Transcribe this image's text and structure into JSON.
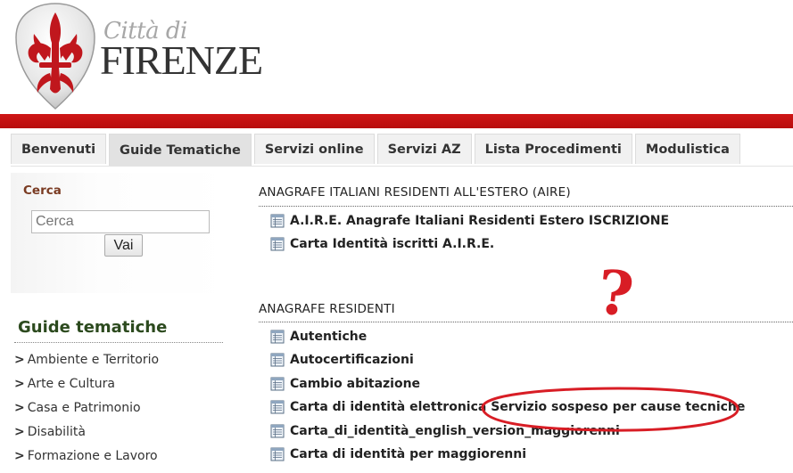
{
  "header": {
    "logo_line1": "Città di",
    "logo_line2": "FIRENZE",
    "brand_red": "#c41111"
  },
  "tabs": [
    {
      "label": "Benvenuti",
      "active": false
    },
    {
      "label": "Guide Tematiche",
      "active": true
    },
    {
      "label": "Servizi online",
      "active": false
    },
    {
      "label": "Servizi AZ",
      "active": false
    },
    {
      "label": "Lista Procedimenti",
      "active": false
    },
    {
      "label": "Modulistica",
      "active": false
    }
  ],
  "search": {
    "title": "Cerca",
    "placeholder": "Cerca",
    "button_label": "Vai"
  },
  "guide": {
    "title": "Guide tematiche",
    "items": [
      "Ambiente e Territorio",
      "Arte e Cultura",
      "Casa e Patrimonio",
      "Disabilità",
      "Formazione e Lavoro"
    ]
  },
  "sections": [
    {
      "title": "ANAGRAFE ITALIANI RESIDENTI ALL'ESTERO (AIRE)",
      "items": [
        "A.I.R.E. Anagrafe Italiani Residenti Estero ISCRIZIONE",
        "Carta Identità iscritti A.I.R.E."
      ]
    },
    {
      "title": "ANAGRAFE RESIDENTI",
      "items": [
        "Autentiche",
        "Autocertificazioni",
        "Cambio abitazione",
        "Carta di identità elettronica Servizio sospeso per cause tecniche",
        "Carta_di_identità_english_version_maggiorenni",
        "Carta di identità per maggiorenni"
      ]
    }
  ],
  "annotation": {
    "mark": "?",
    "color": "#d81d25"
  }
}
